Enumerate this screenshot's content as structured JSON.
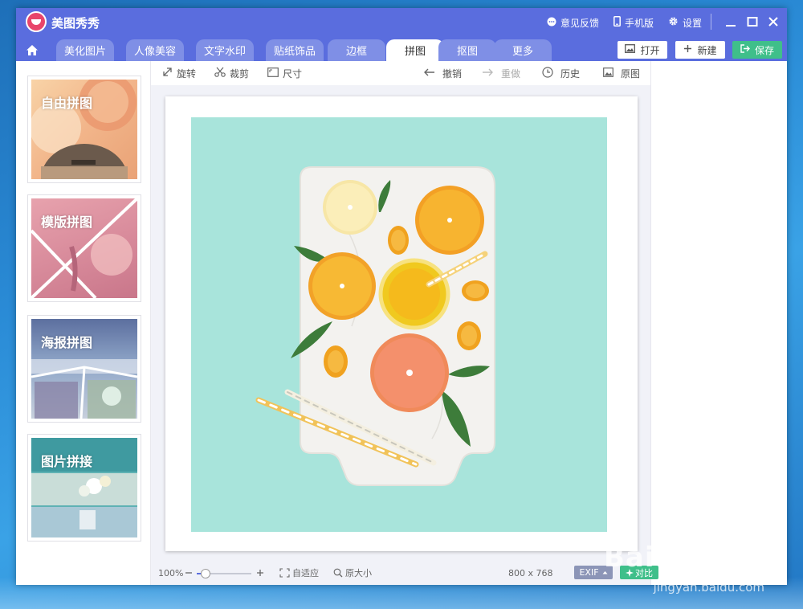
{
  "app": {
    "title": "美图秀秀",
    "links": {
      "feedback": "意见反馈",
      "mobile": "手机版",
      "settings": "设置"
    }
  },
  "tabs": [
    {
      "label": "美化图片"
    },
    {
      "label": "人像美容"
    },
    {
      "label": "文字水印"
    },
    {
      "label": "贴纸饰品"
    },
    {
      "label": "边框"
    },
    {
      "label": "拼图",
      "active": true
    },
    {
      "label": "抠图"
    },
    {
      "label": "更多"
    }
  ],
  "actions": {
    "open": "打开",
    "new": "新建",
    "save": "保存"
  },
  "toolbar": {
    "rotate": "旋转",
    "crop": "裁剪",
    "size": "尺寸",
    "undo": "撤销",
    "redo": "重做",
    "history": "历史",
    "original": "原图"
  },
  "collage_modes": [
    {
      "label": "自由拼图"
    },
    {
      "label": "模版拼图"
    },
    {
      "label": "海报拼图"
    },
    {
      "label": "图片拼接"
    }
  ],
  "status": {
    "zoom": "100%",
    "zoom_level": 0.08,
    "fit": "自适应",
    "actual_size": "原大小",
    "dimensions": "800 x 768",
    "exif": "EXIF",
    "compare": "对比"
  },
  "watermark": {
    "main": "Baidu经验",
    "sub": "jingyan.baidu.com"
  },
  "colors": {
    "accent": "#5a6dde",
    "save": "#3fbf8a",
    "canvas_bg": "#a8e4db"
  }
}
